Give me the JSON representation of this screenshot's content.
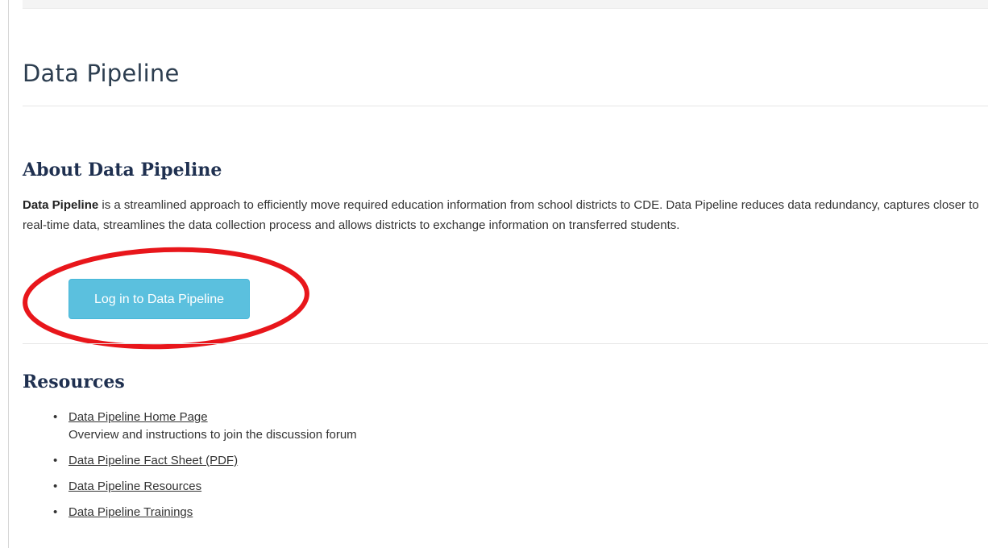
{
  "page": {
    "title": "Data Pipeline"
  },
  "about": {
    "heading": "About Data Pipeline",
    "lead_bold": "Data Pipeline",
    "body": " is a streamlined approach to efficiently move required education information from school districts to CDE. Data Pipeline reduces data redundancy, captures closer to real-time data, streamlines the data collection process and allows districts to exchange information on transferred students.",
    "login_button": "Log in to Data Pipeline"
  },
  "resources": {
    "heading": "Resources",
    "bullet": "•",
    "items": [
      {
        "link": "Data Pipeline Home Page",
        "description": "Overview and instructions to join the discussion forum"
      },
      {
        "link": "Data Pipeline Fact Sheet (PDF)"
      },
      {
        "link": "Data Pipeline Resources"
      },
      {
        "link": "Data Pipeline Trainings"
      }
    ]
  },
  "colors": {
    "button_bg": "#5bc0de",
    "annotation_circle": "#e8161b",
    "heading": "#1f3050"
  }
}
